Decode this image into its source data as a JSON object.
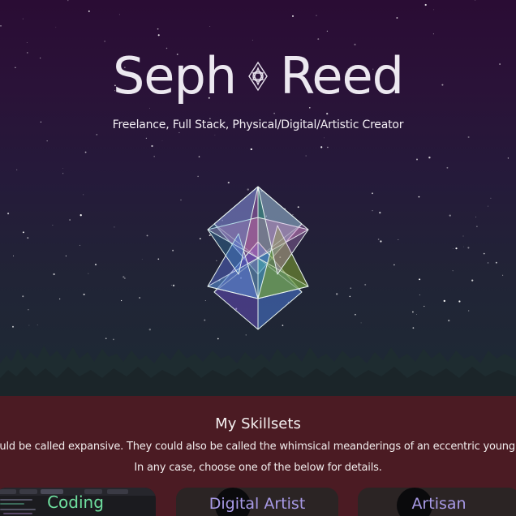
{
  "hero": {
    "title_left": "Seph",
    "title_right": "Reed",
    "subtitle": "Freelance, Full Stack, Physical/Digital/Artistic Creator"
  },
  "skills": {
    "heading": "My Skillsets",
    "description": "could be called expansive. They could also be called the whimsical meanderings of an eccentric young m",
    "hint": "In any case, choose one of the below for details.",
    "cards": [
      {
        "label": "Coding"
      },
      {
        "label": "Digital Artist"
      },
      {
        "label": "Artisan"
      }
    ]
  },
  "colors": {
    "hero_top": "#2a0c34",
    "hero_bottom": "#1d2a34",
    "skills_bg": "#4b1b23",
    "coding_accent": "#6fe0a0",
    "card_label": "#a89ae6"
  },
  "icons": [
    "seed-of-life-logo-icon",
    "stellated-octahedron-graphic",
    "forest-silhouette",
    "starfield"
  ]
}
